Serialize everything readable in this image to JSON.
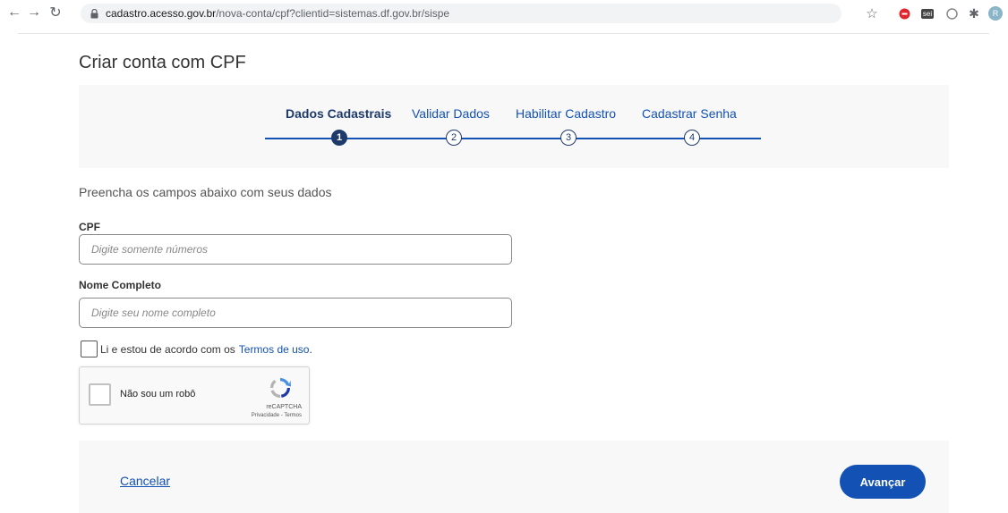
{
  "browser": {
    "url_host": "cadastro.acesso.gov.br",
    "url_path": "/nova-conta/cpf?clientid=sistemas.df.gov.br/sispe",
    "ext_sei_label": "sei",
    "profile_initial": "R"
  },
  "page": {
    "title": "Criar conta com CPF",
    "intro": "Preencha os campos abaixo com seus dados"
  },
  "steps": [
    {
      "label": "Dados Cadastrais",
      "number": "1",
      "active": true
    },
    {
      "label": "Validar Dados",
      "number": "2",
      "active": false
    },
    {
      "label": "Habilitar Cadastro",
      "number": "3",
      "active": false
    },
    {
      "label": "Cadastrar Senha",
      "number": "4",
      "active": false
    }
  ],
  "form": {
    "cpf_label": "CPF",
    "cpf_placeholder": "Digite somente números",
    "cpf_value": "",
    "name_label": "Nome Completo",
    "name_placeholder": "Digite seu nome completo",
    "name_value": "",
    "terms_prefix": "Li e estou de acordo com os",
    "terms_link": "Termos de uso",
    "terms_suffix": ".",
    "terms_checked": false
  },
  "captcha": {
    "label": "Não sou um robô",
    "brand": "reCAPTCHA",
    "links": "Privacidade - Termos"
  },
  "footer": {
    "cancel_label": "Cancelar",
    "next_label": "Avançar"
  },
  "colors": {
    "primary": "#1351b4",
    "step_active": "#1e3a6b",
    "panel_bg": "#f8f8f8"
  }
}
